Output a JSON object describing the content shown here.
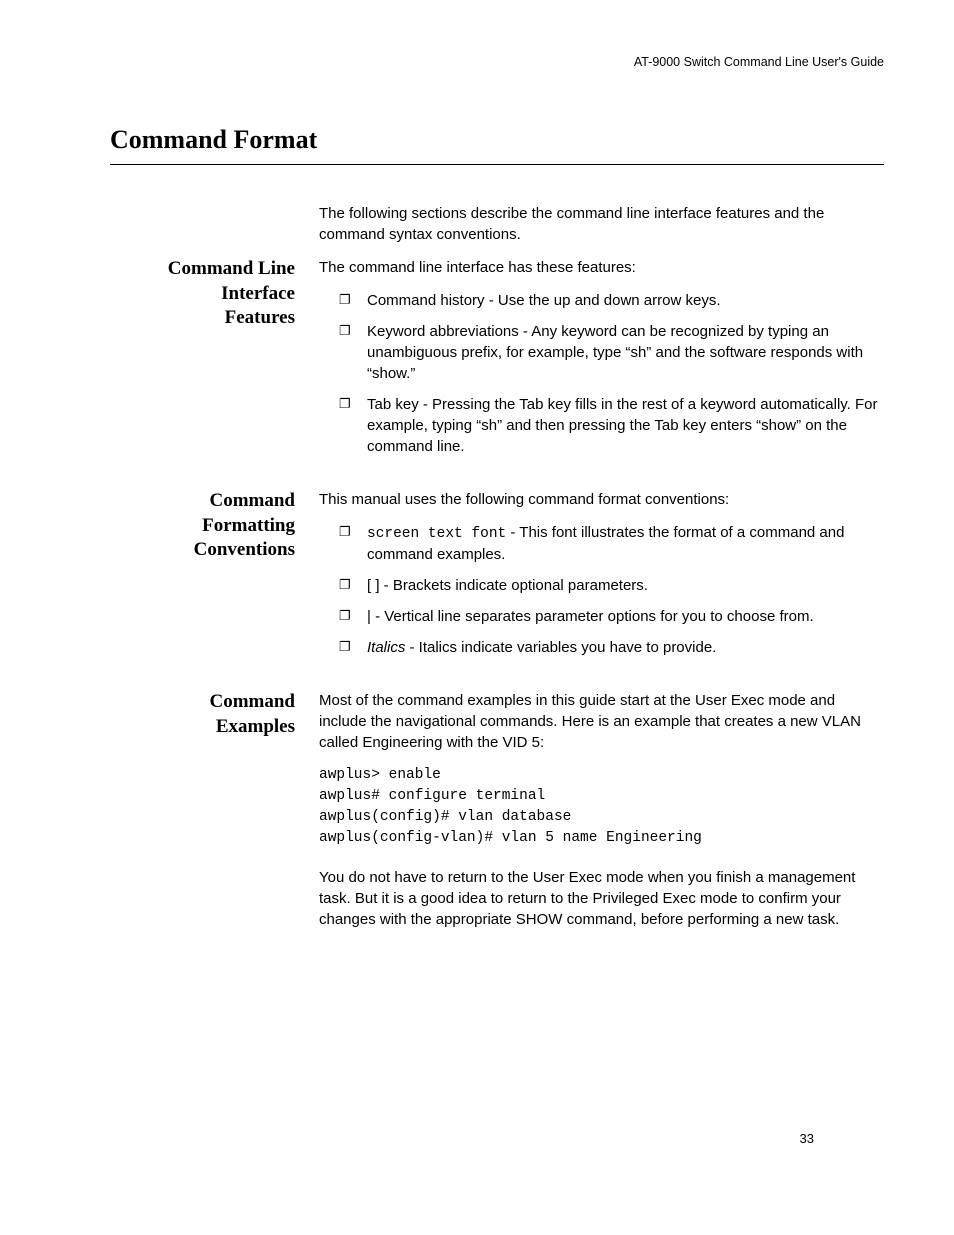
{
  "header": {
    "guide_title": "AT-9000 Switch Command Line User's Guide"
  },
  "section": {
    "title": "Command Format",
    "intro": "The following sections describe the command line interface features and the command syntax conventions."
  },
  "cli_features": {
    "heading_line1": "Command Line",
    "heading_line2": "Interface",
    "heading_line3": "Features",
    "lead": "The command line interface has these features:",
    "items": [
      "Command history - Use the up and down arrow keys.",
      "Keyword abbreviations - Any keyword can be recognized by typing an unambiguous prefix, for example, type “sh” and the software responds with “show.”",
      "Tab key - Pressing the Tab key fills in the rest of a keyword automatically. For example, typing “sh” and then pressing the Tab key enters “show” on the command line."
    ]
  },
  "formatting": {
    "heading_line1": "Command",
    "heading_line2": "Formatting",
    "heading_line3": "Conventions",
    "lead": "This manual uses the following command format conventions:",
    "item1_code": "screen text font",
    "item1_rest": " - This font illustrates the format of a command and command examples.",
    "item2": "[ ] - Brackets indicate optional parameters.",
    "item3": "| - Vertical line separates parameter options for you to choose from.",
    "item4_italic": "Italics",
    "item4_rest": " - Italics indicate variables you have to provide."
  },
  "examples": {
    "heading_line1": "Command",
    "heading_line2": "Examples",
    "para1": "Most of the command examples in this guide start at the User Exec mode and include the navigational commands. Here is an example that creates a new VLAN called Engineering with the VID 5:",
    "code": "awplus> enable\nawplus# configure terminal\nawplus(config)# vlan database\nawplus(config-vlan)# vlan 5 name Engineering",
    "para2": "You do not have to return to the User Exec mode when you finish a management task. But it is a good idea to return to the Privileged Exec mode to confirm your changes with the appropriate SHOW command, before performing a new task."
  },
  "page_number": "33",
  "bullet_glyph": "❐"
}
